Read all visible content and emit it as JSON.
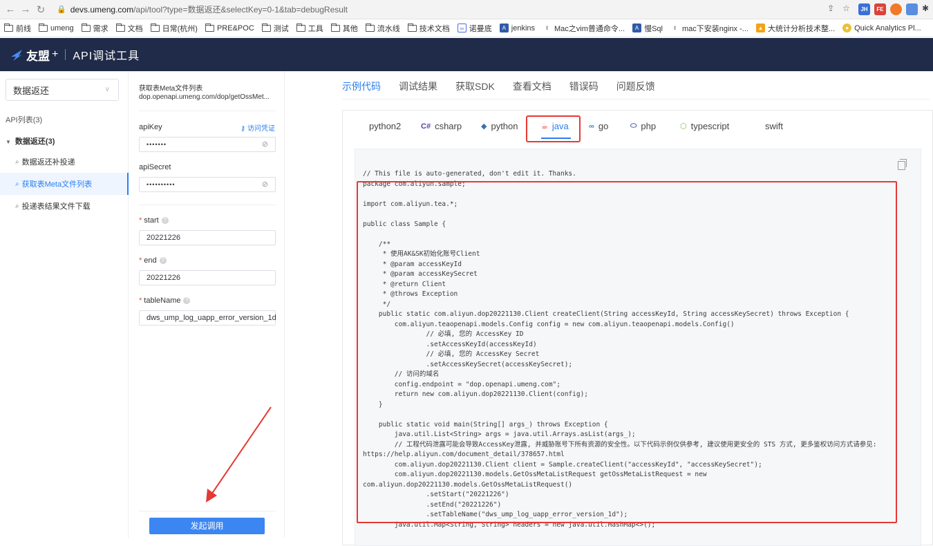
{
  "browser": {
    "url_host": "devs.umeng.com",
    "url_path": "/api/tool?type=数据返还&selectKey=0-1&tab=debugResult",
    "bookmarks": [
      "前线",
      "umeng",
      "需求",
      "文档",
      "日常(杭州)",
      "PRE&POC",
      "测试",
      "工具",
      "其他",
      "流水线",
      "技术文档",
      "诺曼底",
      "jenkins",
      "Mac之vim普通命令...",
      "慢Sql",
      "mac下安装nginx -...",
      "大统计分析技术整...",
      "Quick Analytics Pl..."
    ],
    "extensions": [
      "JH",
      "FE",
      "",
      ""
    ]
  },
  "header": {
    "brand": "友盟",
    "plus": "+",
    "title": "API调试工具"
  },
  "sidebar": {
    "select_value": "数据返还",
    "api_count": "API列表(3)",
    "group": "数据返还(3)",
    "items": [
      {
        "label": "数据返还补投递"
      },
      {
        "label": "获取表Meta文件列表"
      },
      {
        "label": "投递表结果文件下载"
      }
    ]
  },
  "form": {
    "api_name": "获取表Meta文件列表",
    "api_path": "dop.openapi.umeng.com/dop/getOssMet...",
    "credential_link": "访问凭证",
    "api_key_label": "apiKey",
    "api_key_value": "•••••••",
    "api_secret_label": "apiSecret",
    "api_secret_value": "••••••••••",
    "start_label": "start",
    "start_value": "20221226",
    "end_label": "end",
    "end_value": "20221226",
    "table_label": "tableName",
    "table_value": "dws_ump_log_uapp_error_version_1d",
    "invoke_button": "发起调用"
  },
  "main": {
    "tabs": [
      "示例代码",
      "调试结果",
      "获取SDK",
      "查看文档",
      "错误码",
      "问题反馈"
    ],
    "active_tab": "示例代码",
    "languages": [
      {
        "label": "python2",
        "icon": ""
      },
      {
        "label": "csharp",
        "icon": "C#"
      },
      {
        "label": "python",
        "icon": "py"
      },
      {
        "label": "java",
        "icon": "cup"
      },
      {
        "label": "go",
        "icon": "go"
      },
      {
        "label": "php",
        "icon": "php"
      },
      {
        "label": "typescript",
        "icon": "ts"
      },
      {
        "label": "swift",
        "icon": ""
      }
    ],
    "active_language": "java",
    "code": "// This file is auto-generated, don't edit it. Thanks.\npackage com.aliyun.sample;\n\nimport com.aliyun.tea.*;\n\npublic class Sample {\n\n    /**\n     * 使用AK&SK初始化账号Client\n     * @param accessKeyId\n     * @param accessKeySecret\n     * @return Client\n     * @throws Exception\n     */\n    public static com.aliyun.dop20221130.Client createClient(String accessKeyId, String accessKeySecret) throws Exception {\n        com.aliyun.teaopenapi.models.Config config = new com.aliyun.teaopenapi.models.Config()\n                // 必填, 您的 AccessKey ID\n                .setAccessKeyId(accessKeyId)\n                // 必填, 您的 AccessKey Secret\n                .setAccessKeySecret(accessKeySecret);\n        // 访问的域名\n        config.endpoint = \"dop.openapi.umeng.com\";\n        return new com.aliyun.dop20221130.Client(config);\n    }\n\n    public static void main(String[] args_) throws Exception {\n        java.util.List<String> args = java.util.Arrays.asList(args_);\n        // 工程代码泄露可能会导致AccessKey泄露, 并威胁账号下所有资源的安全性。以下代码示例仅供参考, 建议使用更安全的 STS 方式, 更多鉴权访问方式请参见:\nhttps://help.aliyun.com/document_detail/378657.html\n        com.aliyun.dop20221130.Client client = Sample.createClient(\"accessKeyId\", \"accessKeySecret\");\n        com.aliyun.dop20221130.models.GetOssMetaListRequest getOssMetaListRequest = new\ncom.aliyun.dop20221130.models.GetOssMetaListRequest()\n                .setStart(\"20221226\")\n                .setEnd(\"20221226\")\n                .setTableName(\"dws_ump_log_uapp_error_version_1d\");\n        java.util.Map<String, String> headers = new java.util.HashMap<>();"
  },
  "colors": {
    "accent": "#2a7ef0",
    "header_bg": "#1f2b48",
    "annotation_red": "#e53935"
  }
}
